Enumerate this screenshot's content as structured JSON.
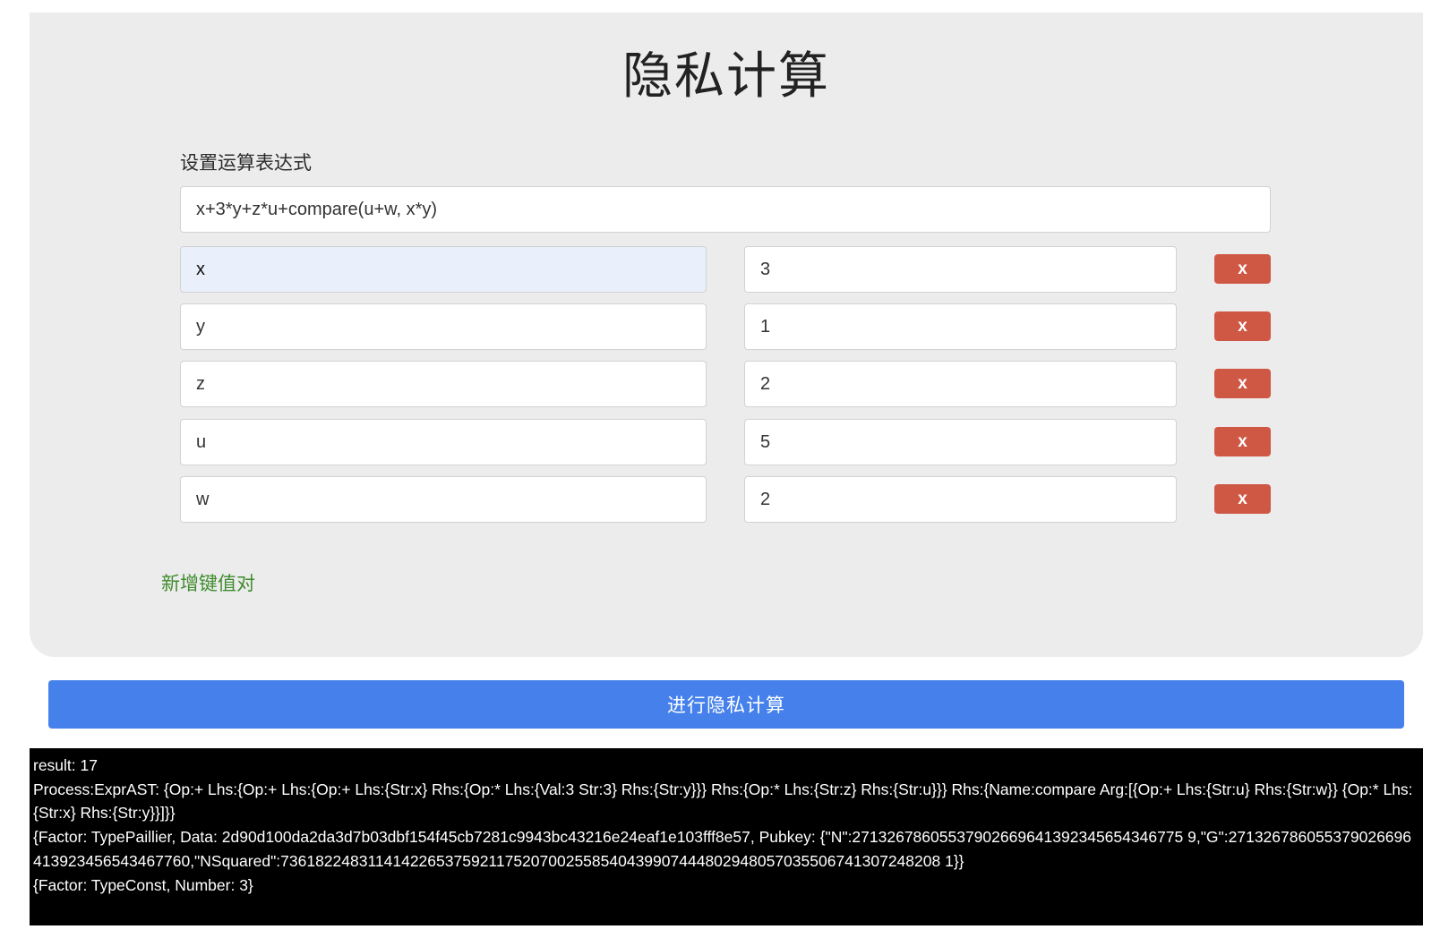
{
  "title": "隐私计算",
  "expression": {
    "label": "设置运算表达式",
    "value": "x+3*y+z*u+compare(u+w, x*y)"
  },
  "pairs": [
    {
      "key": "x",
      "value": "3",
      "delete_label": "x"
    },
    {
      "key": "y",
      "value": "1",
      "delete_label": "x"
    },
    {
      "key": "z",
      "value": "2",
      "delete_label": "x"
    },
    {
      "key": "u",
      "value": "5",
      "delete_label": "x"
    },
    {
      "key": "w",
      "value": "2",
      "delete_label": "x"
    }
  ],
  "add_pair_label": "新增键值对",
  "compute_button_label": "进行隐私计算",
  "output": {
    "lines": [
      "result: 17",
      "Process:ExprAST: {Op:+ Lhs:{Op:+ Lhs:{Op:+ Lhs:{Str:x} Rhs:{Op:* Lhs:{Val:3 Str:3} Rhs:{Str:y}}} Rhs:{Op:* Lhs:{Str:z} Rhs:{Str:u}}} Rhs:{Name:compare Arg:[{Op:+ Lhs:{Str:u} Rhs:{Str:w}} {Op:* Lhs:{Str:x} Rhs:{Str:y}}]}}",
      "{Factor: TypePaillier, Data: 2d90d100da2da3d7b03dbf154f45cb7281c9943bc43216e24eaf1e103fff8e57, Pubkey: {\"N\":27132678605537902669641392345654346775 9,\"G\":271326786055379026696413923456543467760,\"NSquared\":7361822483114142265375921175207002558540439907444802948057035506741307248208 1}}",
      "{Factor: TypeConst, Number: 3}"
    ]
  },
  "colors": {
    "panel_bg": "#ececec",
    "delete_button": "#cf5845",
    "add_link": "#3f8c2e",
    "compute_button": "#4580eb",
    "console_bg": "#000000"
  }
}
